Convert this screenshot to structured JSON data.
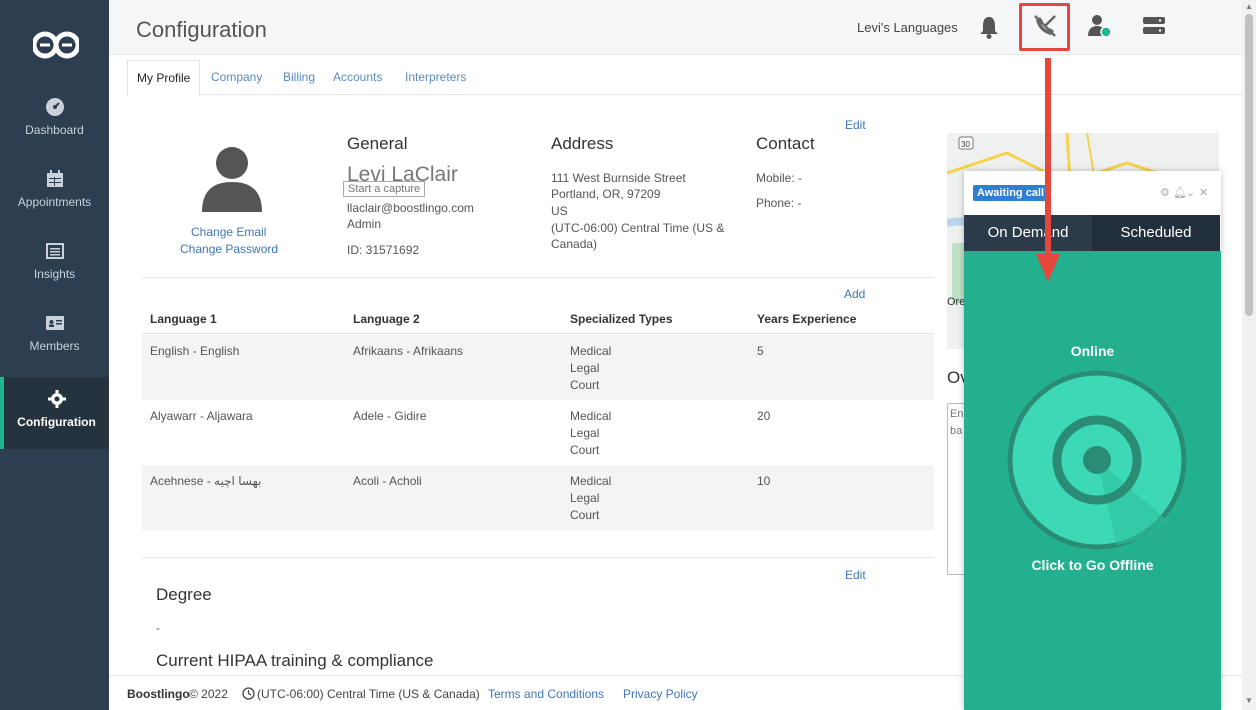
{
  "sidebar": {
    "items": [
      {
        "label": "Dashboard",
        "icon": "dashboard-icon"
      },
      {
        "label": "Appointments",
        "icon": "calendar-icon"
      },
      {
        "label": "Insights",
        "icon": "insights-icon"
      },
      {
        "label": "Members",
        "icon": "id-card-icon"
      },
      {
        "label": "Configuration",
        "icon": "gear-icon",
        "active": true
      }
    ]
  },
  "header": {
    "title": "Configuration",
    "company": "Levi's Languages"
  },
  "tabs": [
    "My Profile",
    "Company",
    "Billing",
    "Accounts",
    "Interpreters"
  ],
  "profile": {
    "change_email": "Change Email",
    "change_password": "Change Password",
    "edit": "Edit",
    "general": {
      "heading": "General",
      "name": "Levi LaClair",
      "tooltip": "Start a capture",
      "email": "llaclair@boostlingo.com",
      "role": "Admin",
      "id": "ID: 31571692"
    },
    "address": {
      "heading": "Address",
      "line1": "111 West Burnside Street",
      "line2": "Portland, OR, 97209",
      "line3": "US",
      "line4": "(UTC-06:00) Central Time (US &",
      "line5": "Canada)"
    },
    "contact": {
      "heading": "Contact",
      "mobile": "Mobile:  -",
      "phone": "Phone:  -"
    }
  },
  "languages": {
    "add": "Add",
    "headers": [
      "Language 1",
      "Language 2",
      "Specialized Types",
      "Years Experience"
    ],
    "rows": [
      {
        "lang1": "English - English",
        "lang2": "Afrikaans - Afrikaans",
        "types": [
          "Medical",
          "Legal",
          "Court"
        ],
        "years": "5"
      },
      {
        "lang1": "Alyawarr - Aljawara",
        "lang2": "Adele - Gidire",
        "types": [
          "Medical",
          "Legal",
          "Court"
        ],
        "years": "20"
      },
      {
        "lang1": "Acehnese - بهسا اچيه",
        "lang2": "Acoli - Acholi",
        "types": [
          "Medical",
          "Legal",
          "Court"
        ],
        "years": "10"
      }
    ]
  },
  "degree": {
    "edit": "Edit",
    "heading": "Degree",
    "value": "-",
    "hipaa_heading": "Current HIPAA training & compliance"
  },
  "right_panel": {
    "overview_partial": "Ov",
    "notes_partial_1": "En",
    "notes_partial_2": "ba",
    "map_label": "Ore",
    "map_shield": "30"
  },
  "footer": {
    "brand": "Boostlingo",
    "copyright": "© 2022",
    "timezone": "(UTC-06:00) Central Time (US & Canada)",
    "terms": "Terms and Conditions",
    "privacy": "Privacy Policy"
  },
  "widget": {
    "status_badge": "Awaiting call",
    "tabs": [
      "On Demand",
      "Scheduled"
    ],
    "status": "Online",
    "action": "Click to Go Offline"
  },
  "colors": {
    "sidebar": "#2d3e50",
    "accent_green": "#22b08e",
    "link": "#3f76b5",
    "highlight": "#e5473b"
  }
}
